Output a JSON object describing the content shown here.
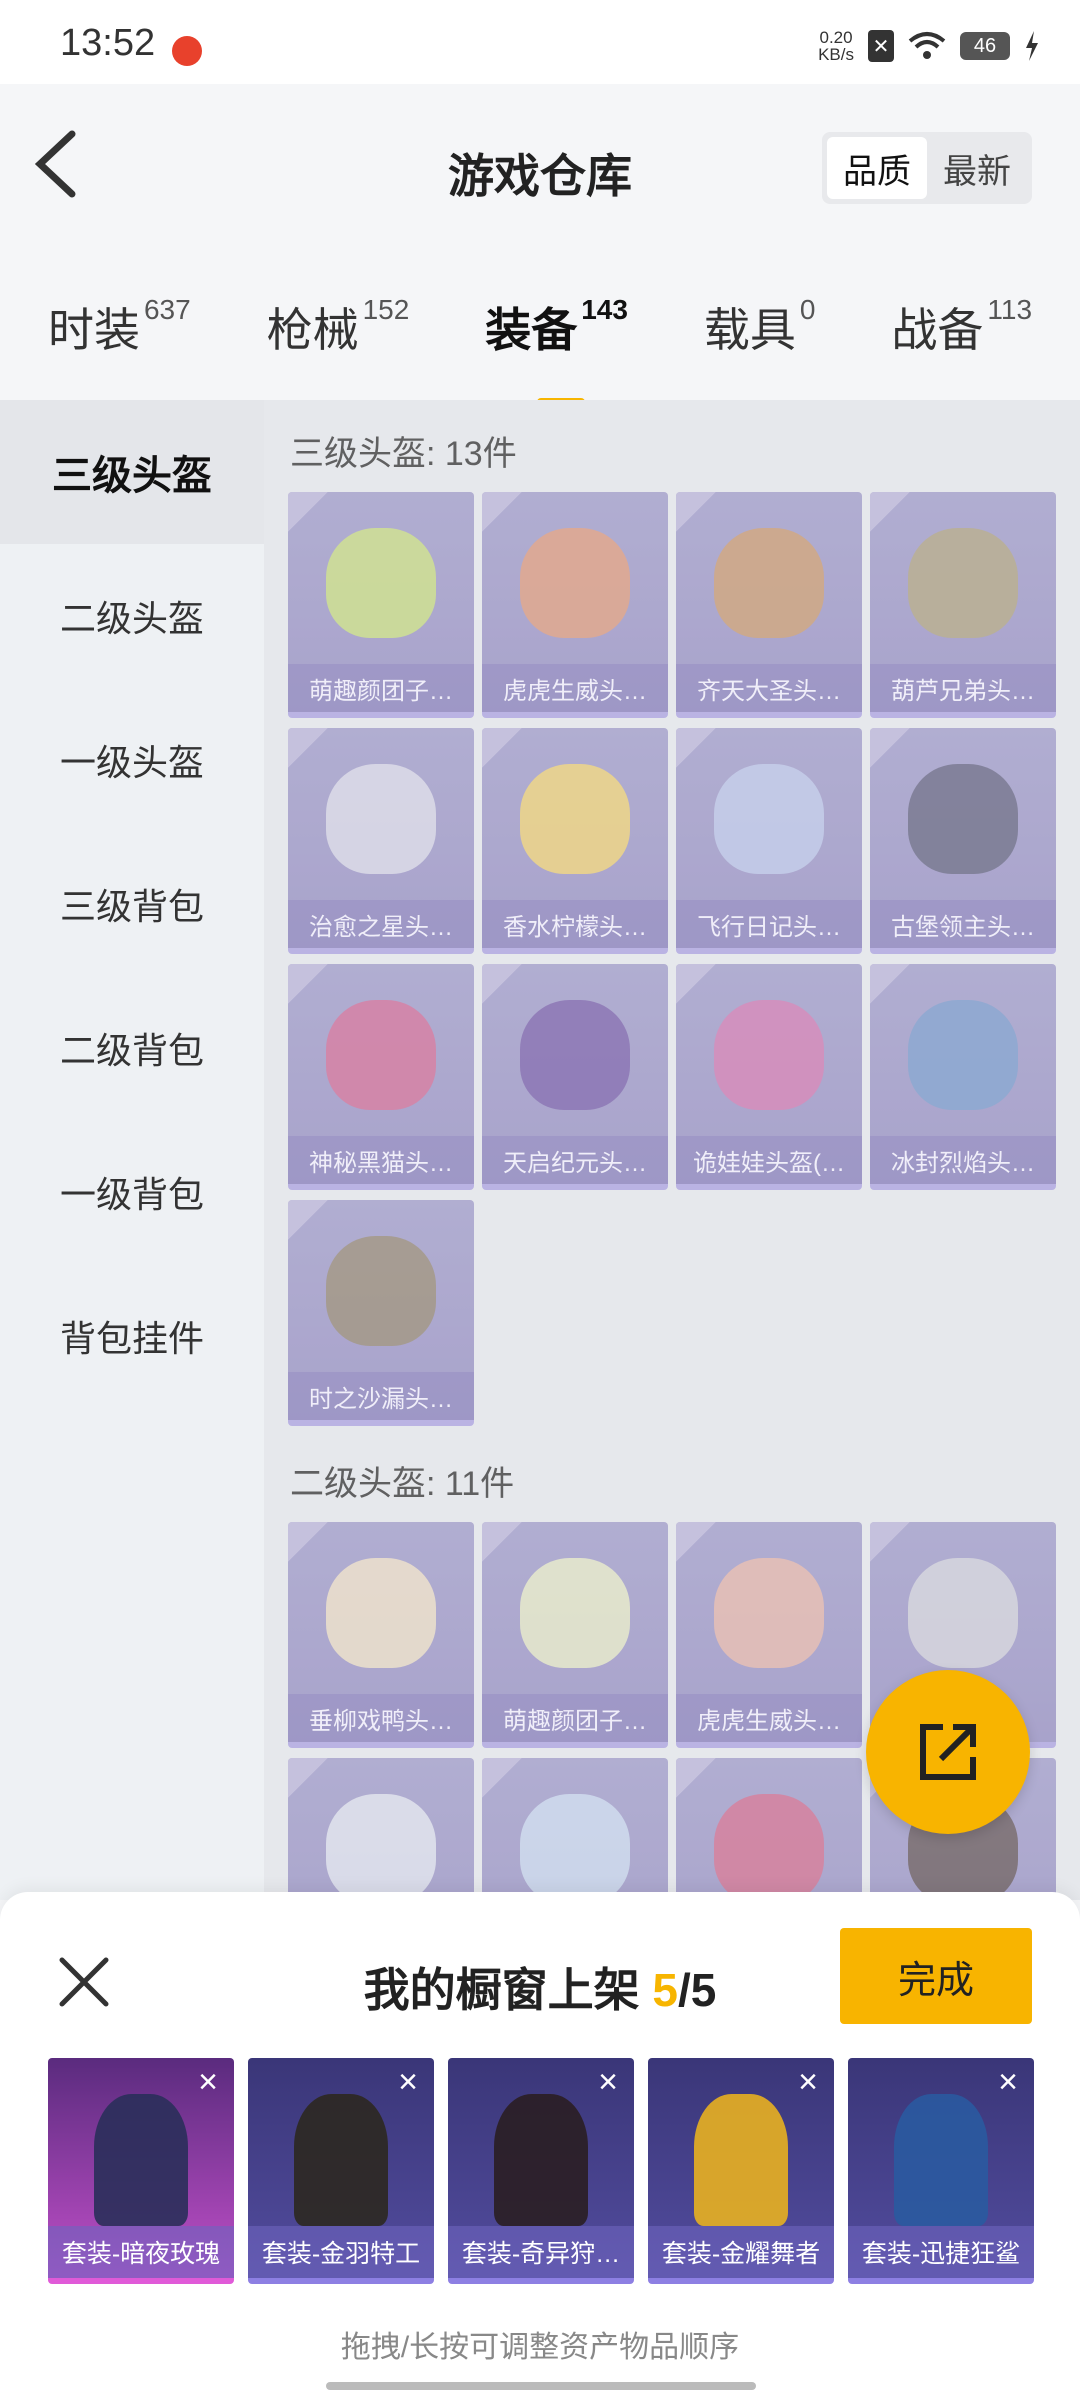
{
  "status_bar": {
    "time": "13:52",
    "net_speed_value": "0.20",
    "net_speed_unit": "KB/s",
    "battery": "46"
  },
  "header": {
    "title": "游戏仓库",
    "sort_options": [
      "品质",
      "最新"
    ],
    "sort_selected": "品质"
  },
  "tabs": [
    {
      "label": "时装",
      "count": "637"
    },
    {
      "label": "枪械",
      "count": "152"
    },
    {
      "label": "装备",
      "count": "143"
    },
    {
      "label": "载具",
      "count": "0"
    },
    {
      "label": "战备",
      "count": "113"
    }
  ],
  "active_tab": "装备",
  "side_menu": [
    "三级头盔",
    "二级头盔",
    "一级头盔",
    "三级背包",
    "二级背包",
    "一级背包",
    "背包挂件"
  ],
  "active_side": "三级头盔",
  "sections": [
    {
      "title": "三级头盔: 13件",
      "items": [
        {
          "name": "萌趣颜团子…",
          "color": "#c8e070"
        },
        {
          "name": "虎虎生威头…",
          "color": "#e0906a"
        },
        {
          "name": "齐天大圣头…",
          "color": "#c9905a"
        },
        {
          "name": "葫芦兄弟头…",
          "color": "#a89a70"
        },
        {
          "name": "治愈之星头…",
          "color": "#d8d8e8"
        },
        {
          "name": "香水柠檬头…",
          "color": "#f2d060"
        },
        {
          "name": "飞行日记头…",
          "color": "#b8c4ea"
        },
        {
          "name": "古堡领主头…",
          "color": "#505070"
        },
        {
          "name": "神秘黑猫头…",
          "color": "#d05a8a"
        },
        {
          "name": "天启纪元头…",
          "color": "#6a4aa0"
        },
        {
          "name": "诡娃娃头盔(…",
          "color": "#d06aa8"
        },
        {
          "name": "冰封烈焰头…",
          "color": "#6a90c8"
        },
        {
          "name": "时之沙漏头…",
          "color": "#8a7a60"
        }
      ]
    },
    {
      "title": "二级头盔: 11件",
      "items": [
        {
          "name": "垂柳戏鸭头…",
          "color": "#f0e0c0"
        },
        {
          "name": "萌趣颜团子…",
          "color": "#e8ecc0"
        },
        {
          "name": "虎虎生威头…",
          "color": "#e8b0a0"
        },
        {
          "name": "",
          "color": "#d0d0d8"
        },
        {
          "name": "",
          "color": "#e0e4ee"
        },
        {
          "name": "",
          "color": "#c8d8f0"
        },
        {
          "name": "",
          "color": "#d05a80"
        },
        {
          "name": "",
          "color": "#504040"
        }
      ]
    }
  ],
  "sheet": {
    "title_prefix": "我的橱窗上架 ",
    "count_current": "5",
    "count_sep": "/",
    "count_total": "5",
    "done_label": "完成",
    "hint": "拖拽/长按可调整资产物品顺序",
    "showcase": [
      {
        "name": "套装-暗夜玫瑰"
      },
      {
        "name": "套装-金羽特工"
      },
      {
        "name": "套装-奇异狩…"
      },
      {
        "name": "套装-金耀舞者"
      },
      {
        "name": "套装-迅捷狂鲨"
      }
    ]
  },
  "colors": {
    "accent": "#f7b500",
    "card_purple": "#9c97c8"
  }
}
